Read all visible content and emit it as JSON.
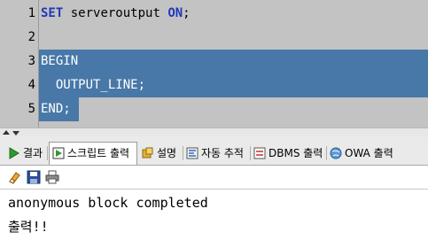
{
  "editor": {
    "lines": [
      {
        "num": "1",
        "kw1": "SET",
        "text1": " serveroutput ",
        "kw2": "ON",
        "text2": ";"
      },
      {
        "num": "2"
      },
      {
        "num": "3",
        "kw1": "BEGIN"
      },
      {
        "num": "4",
        "text1": "  OUTPUT_LINE;"
      },
      {
        "num": "5",
        "kw1": "END",
        "text2": ";"
      }
    ],
    "selection_color": "#4878a8",
    "keyword_color": "#1f38b8"
  },
  "tabs": [
    {
      "label": "결과",
      "icon": "run-icon"
    },
    {
      "label": "스크립트 출력",
      "icon": "script-output-icon",
      "active": true
    },
    {
      "label": "설명",
      "icon": "explain-icon"
    },
    {
      "label": "자동 추적",
      "icon": "autotrace-icon"
    },
    {
      "label": "DBMS 출력",
      "icon": "dbms-output-icon"
    },
    {
      "label": "OWA 출력",
      "icon": "owa-output-icon"
    }
  ],
  "toolbar": {
    "tools": [
      "clear-eraser-icon",
      "save-disk-icon",
      "print-icon"
    ]
  },
  "output": {
    "lines": [
      "anonymous block completed",
      "출력!!"
    ]
  }
}
